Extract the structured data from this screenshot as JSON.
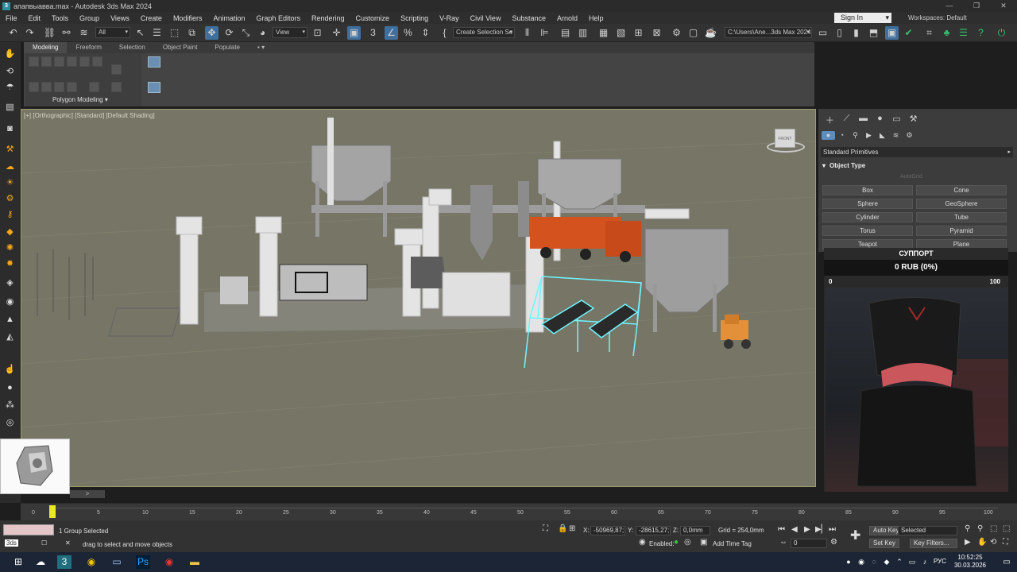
{
  "titlebar": {
    "title": "апапвыавва.max - Autodesk 3ds Max 2024",
    "minimize": "—",
    "maximize": "❐",
    "close": "✕"
  },
  "menu": {
    "items": [
      "File",
      "Edit",
      "Tools",
      "Group",
      "Views",
      "Create",
      "Modifiers",
      "Animation",
      "Graph Editors",
      "Rendering",
      "Customize",
      "Scripting",
      "V-Ray",
      "Civil View",
      "Substance",
      "Arnold",
      "Help"
    ],
    "sign_in": "Sign In",
    "workspaces": "Workspaces: Default"
  },
  "toolbar": {
    "selection_filter": "All",
    "reference_coord": "View",
    "named_selection": "Create Selection Se",
    "project_path": "C:\\Users\\Ane...3ds Max 2024"
  },
  "ribbon": {
    "tabs": [
      "Modeling",
      "Freeform",
      "Selection",
      "Object Paint",
      "Populate"
    ],
    "group_label": "Polygon Modeling ▾"
  },
  "viewport": {
    "label": "[+] [Orthographic] [Standard] [Default Shading]",
    "viewcube_label": "FRONT"
  },
  "command_panel": {
    "category": "Standard Primitives",
    "rollout_title": "Object Type",
    "autogrid": "AutoGrid",
    "buttons": [
      "Box",
      "Cone",
      "Sphere",
      "GeoSphere",
      "Cylinder",
      "Tube",
      "Torus",
      "Pyramid",
      "Teapot",
      "Plane"
    ]
  },
  "donation": {
    "title": "СУППОРТ",
    "amount": "0 RUB (0%)",
    "progress": 0,
    "min": "0",
    "max": "100"
  },
  "timeline": {
    "ticks": [
      "0",
      "5",
      "10",
      "15",
      "20",
      "25",
      "30",
      "35",
      "40",
      "45",
      "50",
      "55",
      "60",
      "65",
      "70",
      "75",
      "80",
      "85",
      "90",
      "95",
      "100"
    ],
    "current_frame": "0 / 100"
  },
  "status": {
    "selection": "1 Group Selected",
    "prompt": "drag to select and move objects",
    "x_label": "X:",
    "x_value": "-50969,87;",
    "y_label": "Y:",
    "y_value": "-28615,27;",
    "z_label": "Z:",
    "z_value": "0,0mm",
    "grid": "Grid = 254,0mm",
    "enabled": "Enabled:",
    "add_time_tag": "Add Time Tag",
    "frame_value": "0",
    "auto_key": "Auto Key",
    "key_mode": "Selected",
    "set_key": "Set Key",
    "key_filters": "Key Filters..."
  },
  "taskbar": {
    "time": "10:52:25",
    "date": "30.03.2026",
    "lang": "РУС"
  },
  "colors": {
    "viewport_bg": "#767566",
    "selection_cyan": "#6ff6ff",
    "truck_orange": "#d4521e",
    "active_blue": "#3f6f9f"
  }
}
